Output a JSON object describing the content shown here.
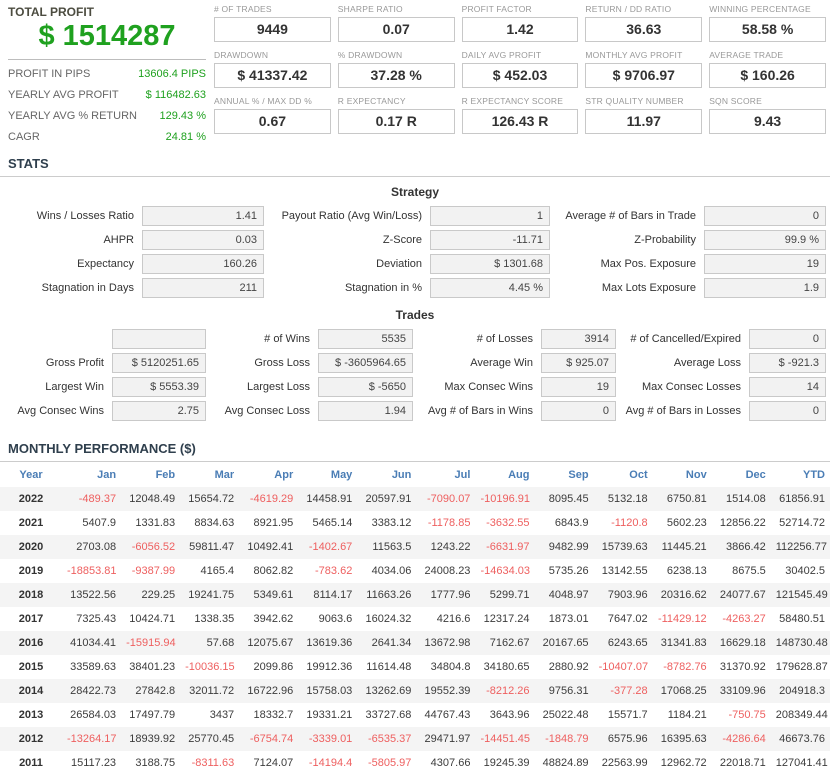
{
  "colors": {
    "profit_green": "#1fa11f",
    "negative_red": "#ee5f5f",
    "header_blue": "#4a7db5"
  },
  "summary": {
    "total_profit_label": "TOTAL PROFIT",
    "total_profit": "$ 1514287",
    "rows": [
      {
        "label": "PROFIT IN PIPS",
        "value": "13606.4 PIPS"
      },
      {
        "label": "YEARLY AVG PROFIT",
        "value": "$ 116482.63"
      },
      {
        "label": "YEARLY AVG % RETURN",
        "value": "129.43 %"
      },
      {
        "label": "CAGR",
        "value": "24.81 %"
      }
    ]
  },
  "metrics": [
    {
      "label": "# OF TRADES",
      "value": "9449"
    },
    {
      "label": "SHARPE RATIO",
      "value": "0.07"
    },
    {
      "label": "PROFIT FACTOR",
      "value": "1.42"
    },
    {
      "label": "RETURN / DD RATIO",
      "value": "36.63"
    },
    {
      "label": "WINNING PERCENTAGE",
      "value": "58.58 %"
    },
    {
      "label": "DRAWDOWN",
      "value": "$ 41337.42"
    },
    {
      "label": "% DRAWDOWN",
      "value": "37.28 %"
    },
    {
      "label": "DAILY AVG PROFIT",
      "value": "$ 452.03"
    },
    {
      "label": "MONTHLY AVG PROFIT",
      "value": "$ 9706.97"
    },
    {
      "label": "AVERAGE TRADE",
      "value": "$ 160.26"
    },
    {
      "label": "ANNUAL % / MAX DD %",
      "value": "0.67"
    },
    {
      "label": "R EXPECTANCY",
      "value": "0.17 R"
    },
    {
      "label": "R EXPECTANCY SCORE",
      "value": "126.43 R"
    },
    {
      "label": "STR QUALITY NUMBER",
      "value": "11.97"
    },
    {
      "label": "SQN SCORE",
      "value": "9.43"
    }
  ],
  "stats": {
    "title": "STATS",
    "strategy": {
      "title": "Strategy",
      "rows": [
        [
          {
            "label": "Wins / Losses Ratio",
            "value": "1.41"
          },
          {
            "label": "Payout Ratio (Avg Win/Loss)",
            "value": "1"
          },
          {
            "label": "Average # of Bars in Trade",
            "value": "0"
          }
        ],
        [
          {
            "label": "AHPR",
            "value": "0.03"
          },
          {
            "label": "Z-Score",
            "value": "-11.71"
          },
          {
            "label": "Z-Probability",
            "value": "99.9 %"
          }
        ],
        [
          {
            "label": "Expectancy",
            "value": "160.26"
          },
          {
            "label": "Deviation",
            "value": "$ 1301.68"
          },
          {
            "label": "Max Pos. Exposure",
            "value": "19"
          }
        ],
        [
          {
            "label": "Stagnation in Days",
            "value": "211"
          },
          {
            "label": "Stagnation in %",
            "value": "4.45 %"
          },
          {
            "label": "Max Lots Exposure",
            "value": "1.9"
          }
        ]
      ]
    },
    "trades": {
      "title": "Trades",
      "rows": [
        [
          {
            "label": "",
            "value": ""
          },
          {
            "label": "# of Wins",
            "value": "5535"
          },
          {
            "label": "# of Losses",
            "value": "3914"
          },
          {
            "label": "# of Cancelled/Expired",
            "value": "0"
          }
        ],
        [
          {
            "label": "Gross Profit",
            "value": "$ 5120251.65"
          },
          {
            "label": "Gross Loss",
            "value": "$ -3605964.65"
          },
          {
            "label": "Average Win",
            "value": "$ 925.07"
          },
          {
            "label": "Average Loss",
            "value": "$ -921.3"
          }
        ],
        [
          {
            "label": "Largest Win",
            "value": "$ 5553.39"
          },
          {
            "label": "Largest Loss",
            "value": "$ -5650"
          },
          {
            "label": "Max Consec Wins",
            "value": "19"
          },
          {
            "label": "Max Consec Losses",
            "value": "14"
          }
        ],
        [
          {
            "label": "Avg Consec Wins",
            "value": "2.75"
          },
          {
            "label": "Avg Consec Loss",
            "value": "1.94"
          },
          {
            "label": "Avg # of Bars in Wins",
            "value": "0"
          },
          {
            "label": "Avg # of Bars in Losses",
            "value": "0"
          }
        ]
      ]
    }
  },
  "monthly": {
    "title": "MONTHLY PERFORMANCE ($)",
    "columns": [
      "Year",
      "Jan",
      "Feb",
      "Mar",
      "Apr",
      "May",
      "Jun",
      "Jul",
      "Aug",
      "Sep",
      "Oct",
      "Nov",
      "Dec",
      "YTD"
    ],
    "rows": [
      {
        "year": "2022",
        "values": [
          "-489.37",
          "12048.49",
          "15654.72",
          "-4619.29",
          "14458.91",
          "20597.91",
          "-7090.07",
          "-10196.91",
          "8095.45",
          "5132.18",
          "6750.81",
          "1514.08",
          "61856.91"
        ]
      },
      {
        "year": "2021",
        "values": [
          "5407.9",
          "1331.83",
          "8834.63",
          "8921.95",
          "5465.14",
          "3383.12",
          "-1178.85",
          "-3632.55",
          "6843.9",
          "-1120.8",
          "5602.23",
          "12856.22",
          "52714.72"
        ]
      },
      {
        "year": "2020",
        "values": [
          "2703.08",
          "-6056.52",
          "59811.47",
          "10492.41",
          "-1402.67",
          "11563.5",
          "1243.22",
          "-6631.97",
          "9482.99",
          "15739.63",
          "11445.21",
          "3866.42",
          "112256.77"
        ]
      },
      {
        "year": "2019",
        "values": [
          "-18853.81",
          "-9387.99",
          "4165.4",
          "8062.82",
          "-783.62",
          "4034.06",
          "24008.23",
          "-14634.03",
          "5735.26",
          "13142.55",
          "6238.13",
          "8675.5",
          "30402.5"
        ]
      },
      {
        "year": "2018",
        "values": [
          "13522.56",
          "229.25",
          "19241.75",
          "5349.61",
          "8114.17",
          "11663.26",
          "1777.96",
          "5299.71",
          "4048.97",
          "7903.96",
          "20316.62",
          "24077.67",
          "121545.49"
        ]
      },
      {
        "year": "2017",
        "values": [
          "7325.43",
          "10424.71",
          "1338.35",
          "3942.62",
          "9063.6",
          "16024.32",
          "4216.6",
          "12317.24",
          "1873.01",
          "7647.02",
          "-11429.12",
          "-4263.27",
          "58480.51"
        ]
      },
      {
        "year": "2016",
        "values": [
          "41034.41",
          "-15915.94",
          "57.68",
          "12075.67",
          "13619.36",
          "2641.34",
          "13672.98",
          "7162.67",
          "20167.65",
          "6243.65",
          "31341.83",
          "16629.18",
          "148730.48"
        ]
      },
      {
        "year": "2015",
        "values": [
          "33589.63",
          "38401.23",
          "-10036.15",
          "2099.86",
          "19912.36",
          "11614.48",
          "34804.8",
          "34180.65",
          "2880.92",
          "-10407.07",
          "-8782.76",
          "31370.92",
          "179628.87"
        ]
      },
      {
        "year": "2014",
        "values": [
          "28422.73",
          "27842.8",
          "32011.72",
          "16722.96",
          "15758.03",
          "13262.69",
          "19552.39",
          "-8212.26",
          "9756.31",
          "-377.28",
          "17068.25",
          "33109.96",
          "204918.3"
        ]
      },
      {
        "year": "2013",
        "values": [
          "26584.03",
          "17497.79",
          "3437",
          "18332.7",
          "19331.21",
          "33727.68",
          "44767.43",
          "3643.96",
          "25022.48",
          "15571.7",
          "1184.21",
          "-750.75",
          "208349.44"
        ]
      },
      {
        "year": "2012",
        "values": [
          "-13264.17",
          "18939.92",
          "25770.45",
          "-6754.74",
          "-3339.01",
          "-6535.37",
          "29471.97",
          "-14451.45",
          "-1848.79",
          "6575.96",
          "16395.63",
          "-4286.64",
          "46673.76"
        ]
      },
      {
        "year": "2011",
        "values": [
          "15117.23",
          "3188.75",
          "-8311.63",
          "7124.07",
          "-14194.4",
          "-5805.97",
          "4307.66",
          "19245.39",
          "48824.89",
          "22563.99",
          "12962.72",
          "22018.71",
          "127041.41"
        ]
      }
    ]
  }
}
